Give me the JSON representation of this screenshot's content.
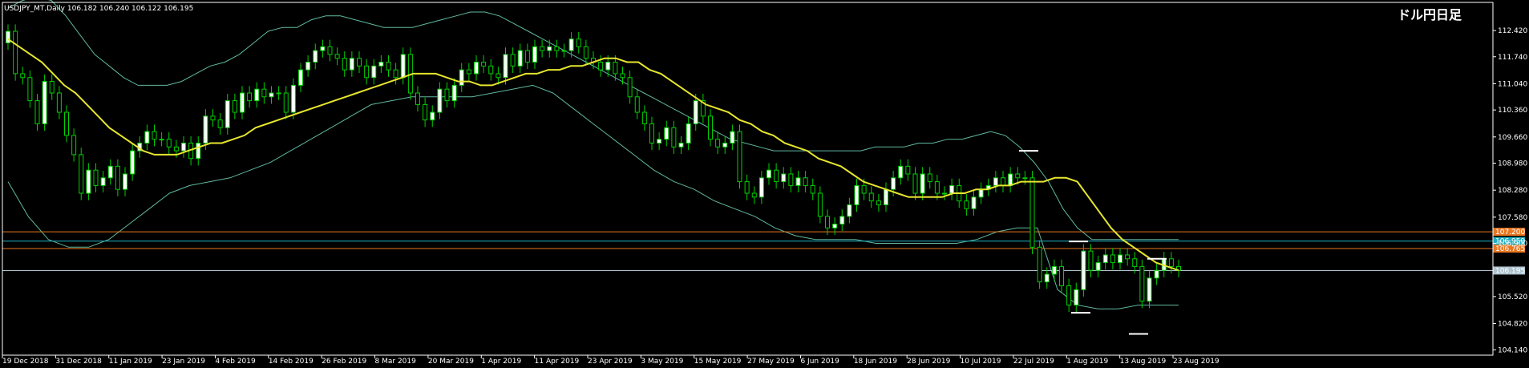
{
  "header": {
    "symbol_line": "USDJPY_MT,Daily  106.182 106.240 106.122 106.195",
    "corner_title": "ドル円日足"
  },
  "chart_data": {
    "type": "candlestick",
    "ylim": [
      104.0,
      112.9
    ],
    "y_ticks": [
      "112.420",
      "111.740",
      "111.040",
      "110.360",
      "109.660",
      "108.980",
      "108.280",
      "107.580",
      "106.900",
      "105.520",
      "104.820",
      "104.140"
    ],
    "x_ticks": [
      "19 Dec 2018",
      "31 Dec 2018",
      "11 Jan 2019",
      "23 Jan 2019",
      "4 Feb 2019",
      "14 Feb 2019",
      "26 Feb 2019",
      "8 Mar 2019",
      "20 Mar 2019",
      "1 Apr 2019",
      "11 Apr 2019",
      "23 Apr 2019",
      "3 May 2019",
      "15 May 2019",
      "27 May 2019",
      "6 Jun 2019",
      "18 Jun 2019",
      "28 Jun 2019",
      "10 Jul 2019",
      "22 Jul 2019",
      "1 Aug 2019",
      "13 Aug 2019",
      "23 Aug 2019"
    ],
    "close": [
      112.4,
      111.3,
      111.2,
      110.6,
      110.0,
      111.1,
      110.8,
      110.3,
      109.7,
      109.2,
      108.2,
      108.8,
      108.4,
      108.6,
      108.9,
      108.3,
      108.7,
      109.3,
      109.5,
      109.8,
      109.6,
      109.6,
      109.4,
      109.3,
      109.5,
      109.1,
      109.5,
      110.2,
      110.1,
      109.9,
      110.6,
      110.3,
      110.8,
      110.6,
      110.9,
      110.7,
      110.8,
      110.8,
      110.3,
      111.0,
      111.4,
      111.6,
      111.9,
      112.0,
      111.8,
      111.7,
      111.4,
      111.7,
      111.5,
      111.2,
      111.5,
      111.6,
      111.4,
      111.2,
      111.8,
      110.8,
      110.5,
      110.1,
      110.3,
      110.9,
      110.6,
      111.0,
      111.4,
      111.3,
      111.6,
      111.5,
      111.3,
      111.2,
      111.8,
      111.5,
      111.9,
      111.6,
      112.0,
      111.9,
      112.0,
      111.9,
      111.9,
      112.2,
      112.0,
      111.7,
      111.6,
      111.4,
      111.6,
      111.3,
      111.2,
      110.7,
      110.3,
      110.0,
      109.5,
      109.6,
      109.9,
      109.4,
      109.5,
      110.0,
      110.6,
      110.2,
      109.6,
      109.4,
      109.5,
      109.8,
      108.5,
      108.2,
      108.1,
      108.6,
      108.8,
      108.5,
      108.7,
      108.4,
      108.6,
      108.4,
      108.2,
      107.6,
      107.3,
      107.4,
      107.6,
      107.9,
      108.4,
      108.2,
      108.0,
      107.9,
      108.3,
      108.6,
      108.9,
      108.7,
      108.2,
      108.7,
      108.5,
      108.2,
      108.2,
      108.4,
      108.0,
      107.8,
      108.1,
      108.3,
      108.4,
      108.6,
      108.4,
      108.7,
      108.6,
      108.6,
      106.8,
      105.9,
      106.1,
      106.3,
      105.8,
      105.3,
      105.7,
      106.7,
      106.2,
      106.4,
      106.6,
      106.4,
      106.6,
      106.5,
      106.3,
      105.4,
      106.0,
      106.2,
      106.5,
      106.3,
      106.2
    ],
    "ma20": [
      112.2,
      112.0,
      111.8,
      111.6,
      111.3,
      111.0,
      110.8,
      110.5,
      110.2,
      109.9,
      109.7,
      109.5,
      109.3,
      109.2,
      109.2,
      109.2,
      109.3,
      109.4,
      109.5,
      109.5,
      109.6,
      109.7,
      109.9,
      110.0,
      110.1,
      110.2,
      110.3,
      110.4,
      110.5,
      110.6,
      110.7,
      110.8,
      110.9,
      111.0,
      111.1,
      111.2,
      111.3,
      111.3,
      111.3,
      111.2,
      111.1,
      111.1,
      111.0,
      111.0,
      111.1,
      111.2,
      111.3,
      111.3,
      111.4,
      111.4,
      111.5,
      111.5,
      111.6,
      111.7,
      111.7,
      111.6,
      111.6,
      111.4,
      111.3,
      111.1,
      110.9,
      110.7,
      110.5,
      110.4,
      110.3,
      110.1,
      110.0,
      109.8,
      109.7,
      109.5,
      109.4,
      109.3,
      109.1,
      109.0,
      108.9,
      108.7,
      108.5,
      108.4,
      108.3,
      108.2,
      108.1,
      108.1,
      108.1,
      108.1,
      108.2,
      108.2,
      108.3,
      108.3,
      108.4,
      108.4,
      108.5,
      108.5,
      108.5,
      108.6,
      108.6,
      108.5,
      108.1,
      107.7,
      107.3,
      107.0,
      106.8,
      106.6,
      106.4,
      106.3,
      106.2
    ],
    "bb_upper": [
      113.0,
      113.2,
      113.3,
      113.2,
      112.8,
      112.3,
      111.8,
      111.5,
      111.2,
      111.0,
      111.0,
      111.0,
      111.1,
      111.3,
      111.5,
      111.6,
      111.8,
      112.1,
      112.4,
      112.5,
      112.5,
      112.7,
      112.8,
      112.8,
      112.7,
      112.6,
      112.5,
      112.5,
      112.5,
      112.6,
      112.7,
      112.8,
      112.9,
      112.9,
      112.8,
      112.6,
      112.4,
      112.2,
      112.0,
      111.8,
      111.6,
      111.4,
      111.2,
      111.0,
      110.8,
      110.6,
      110.4,
      110.2,
      110.0,
      109.8,
      109.6,
      109.5,
      109.4,
      109.3,
      109.3,
      109.3,
      109.3,
      109.3,
      109.3,
      109.3,
      109.4,
      109.4,
      109.4,
      109.5,
      109.5,
      109.6,
      109.6,
      109.7,
      109.8,
      109.7,
      109.4,
      109.0,
      108.5,
      107.8,
      107.3,
      107.0,
      107.0,
      107.0,
      107.0,
      107.0,
      107.0,
      107.0
    ],
    "bb_lower": [
      108.5,
      107.6,
      107.0,
      106.8,
      106.8,
      107.0,
      107.4,
      107.8,
      108.2,
      108.4,
      108.5,
      108.6,
      108.8,
      109.0,
      109.3,
      109.6,
      109.9,
      110.2,
      110.5,
      110.6,
      110.7,
      110.7,
      110.7,
      110.7,
      110.8,
      110.9,
      111.0,
      110.8,
      110.4,
      110.0,
      109.6,
      109.2,
      108.8,
      108.5,
      108.3,
      108.0,
      107.8,
      107.6,
      107.3,
      107.1,
      107.0,
      107.0,
      107.0,
      106.9,
      106.9,
      106.9,
      106.9,
      106.9,
      107.0,
      107.2,
      107.3,
      107.3,
      105.7,
      105.3,
      105.2,
      105.2,
      105.3,
      105.3,
      105.3
    ],
    "hlines": [
      {
        "price": 107.2,
        "label": "107.200",
        "color": "#e87722"
      },
      {
        "price": 106.959,
        "label": "106.959",
        "color": "#20b0c0"
      },
      {
        "price": 106.765,
        "label": "106.765",
        "color": "#e87722"
      },
      {
        "price": 106.195,
        "label": "106.195",
        "color": "#b0c4d0"
      }
    ]
  },
  "colors": {
    "background": "#000000",
    "bull": "#ffffff",
    "bear": "#000000",
    "wick": "#00d000",
    "ma": "#e6e62e",
    "bb": "#5fb8a0",
    "axis": "#ffffff"
  }
}
